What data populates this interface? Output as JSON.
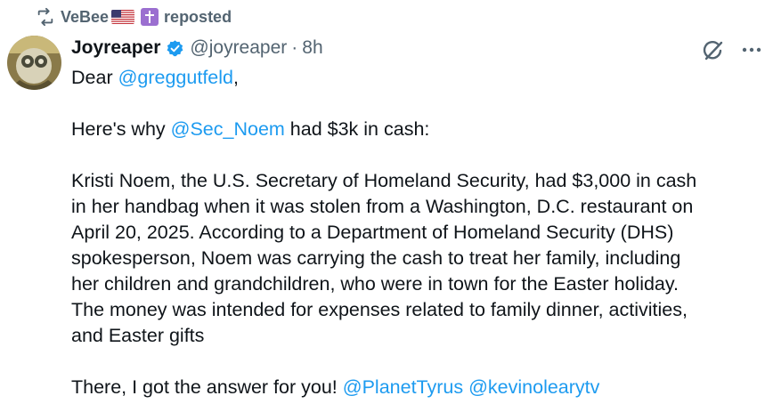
{
  "repost": {
    "user": "VeBee",
    "label": "reposted",
    "emoji_icons": [
      "us-flag-icon",
      "latin-cross-icon"
    ]
  },
  "author": {
    "display_name": "Joyreaper",
    "handle": "@joyreaper",
    "separator": "·",
    "time": "8h",
    "verified": true
  },
  "icons": {
    "repost": "repost-icon",
    "verified": "verified-badge-icon",
    "grok": "grok-icon",
    "more": "more-icon"
  },
  "colors": {
    "link": "#1d9bf0",
    "secondary_text": "#536471",
    "primary_text": "#0f1419",
    "verified": "#1d9bf0"
  },
  "tweet": {
    "line1": {
      "prefix": "Dear ",
      "mention": "@greggutfeld",
      "suffix": ","
    },
    "line2": {
      "prefix": "Here's why ",
      "mention": "@Sec_Noem",
      "suffix": " had $3k in cash:"
    },
    "paragraph": [
      "Kristi Noem, the U.S. Secretary of Homeland Security, had $3,000 in cash",
      "in her handbag when it was stolen from a Washington, D.C. restaurant on",
      "April 20, 2025. According to a Department of Homeland Security (DHS)",
      "spokesperson, Noem was carrying the cash to treat her family, including",
      "her children and grandchildren, who were in town for the Easter holiday.",
      "The money was intended for expenses related to family dinner, activities,",
      "and Easter gifts"
    ],
    "closing": {
      "prefix": "There, I got the answer for you! ",
      "mention1": "@PlanetTyrus",
      "space": " ",
      "mention2": "@kevinolearytv"
    }
  }
}
